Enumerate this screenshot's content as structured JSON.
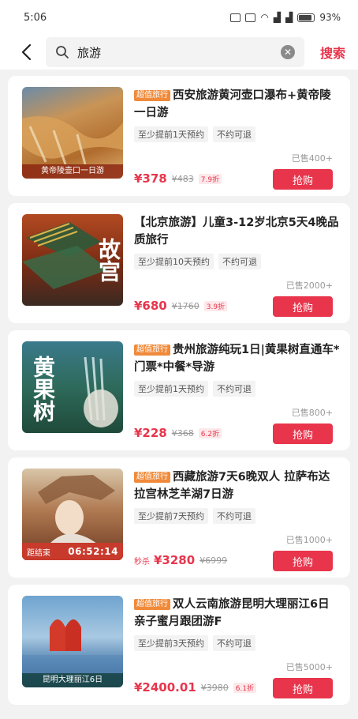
{
  "status_bar": {
    "time": "5:06",
    "battery": "93%"
  },
  "header": {
    "back_icon": "chevron-left-icon",
    "search_query": "旅游",
    "search_button": "搜索"
  },
  "colors": {
    "accent": "#e8354c",
    "badge": "#f08a3a"
  },
  "products": [
    {
      "badge": "超值旅行",
      "title": "西安旅游黄河壶口瀑布+黄帝陵一日游",
      "tags": [
        "至少提前1天预约",
        "不约可退"
      ],
      "sold": "已售400+",
      "flash": "",
      "price": "¥378",
      "original_price": "¥483",
      "discount": "7.9折",
      "buy_label": "抢购",
      "thumb_caption": "黄帝陵壶口一日游"
    },
    {
      "badge": "",
      "title": "【北京旅游】儿童3-12岁北京5天4晚品质旅行",
      "tags": [
        "至少提前10天预约",
        "不约可退"
      ],
      "sold": "已售2000+",
      "flash": "",
      "price": "¥680",
      "original_price": "¥1760",
      "discount": "3.9折",
      "buy_label": "抢购",
      "thumb_text": "故宫"
    },
    {
      "badge": "超值旅行",
      "title": "贵州旅游纯玩1日|黄果树直通车*门票*中餐*导游",
      "tags": [
        "至少提前1天预约",
        "不约可退"
      ],
      "sold": "已售800+",
      "flash": "",
      "price": "¥228",
      "original_price": "¥368",
      "discount": "6.2折",
      "buy_label": "抢购",
      "thumb_text": "黄果树"
    },
    {
      "badge": "超值旅行",
      "title": "西藏旅游7天6晚双人 拉萨布达拉宫林芝羊湖7日游",
      "tags": [
        "至少提前7天预约",
        "不约可退"
      ],
      "sold": "已售1000+",
      "flash": "秒杀",
      "price": "¥3280",
      "original_price": "¥6999",
      "discount": "",
      "buy_label": "抢购",
      "countdown_label": "距结束",
      "countdown": "06:52:14"
    },
    {
      "badge": "超值旅行",
      "title": "双人云南旅游昆明大理丽江6日亲子蜜月跟团游F",
      "tags": [
        "至少提前3天预约",
        "不约可退"
      ],
      "sold": "已售5000+",
      "flash": "",
      "price": "¥2400.01",
      "original_price": "¥3980",
      "discount": "6.1折",
      "buy_label": "抢购",
      "thumb_caption": "昆明大理丽江6日"
    }
  ]
}
